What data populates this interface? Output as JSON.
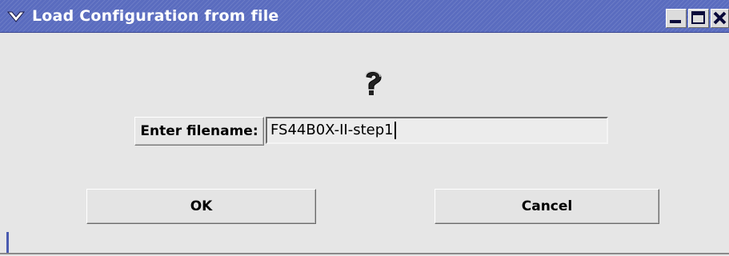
{
  "window": {
    "title": "Load Configuration from file",
    "titlebar_color": "#5a6cbf",
    "menu_icon": "chevron-down-icon",
    "controls": [
      "minimize-icon",
      "maximize-icon",
      "close-icon"
    ]
  },
  "dialog": {
    "icon": "question-icon",
    "filename_label": "Enter filename:",
    "filename_value": "FS44B0X-II-step1"
  },
  "buttons": {
    "ok_label": "OK",
    "cancel_label": "Cancel"
  }
}
